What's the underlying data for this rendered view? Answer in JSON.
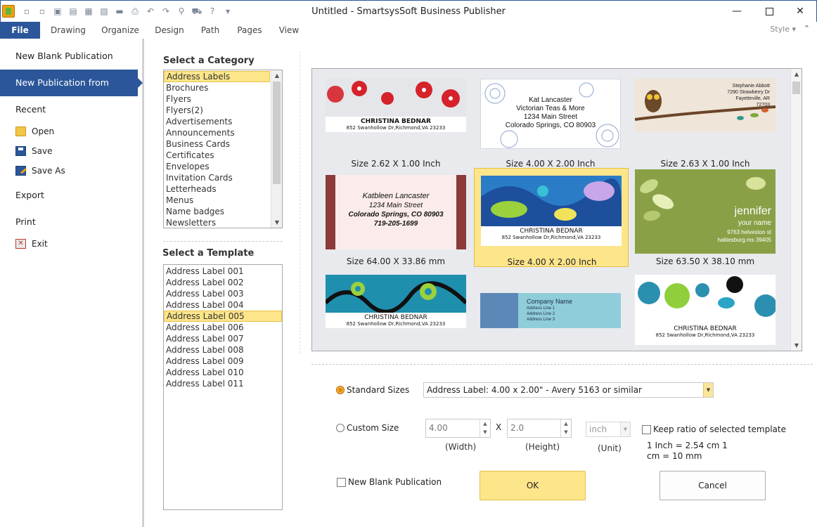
{
  "window": {
    "title": "Untitled - SmartsysSoft Business Publisher",
    "minimize": "—",
    "close": "✕"
  },
  "ribbon": {
    "tabs": [
      "File",
      "Drawing",
      "Organize",
      "Design",
      "Path",
      "Pages",
      "View"
    ],
    "style_label": "Style",
    "style_caret": "▾",
    "collapse_icon": "⌃"
  },
  "qat_icons": [
    "▫",
    "▫",
    "▣",
    "▤",
    "▦",
    "▧",
    "▬",
    "⎙",
    "↶",
    "↷",
    "⚲",
    "⛟",
    "?",
    "▾"
  ],
  "backstage": {
    "new_blank": "New Blank Publication",
    "new_from_template": "New Publication from Template",
    "recent": "Recent",
    "open": "Open",
    "save": "Save",
    "save_as": "Save As",
    "export": "Export",
    "print": "Print",
    "exit": "Exit",
    "exit_glyph": "✕"
  },
  "category": {
    "heading": "Select a Category",
    "items": [
      "Address Labels",
      "Brochures",
      "Flyers",
      "Flyers(2)",
      "Advertisements",
      "Announcements",
      "Business Cards",
      "Certificates",
      "Envelopes",
      "Invitation Cards",
      "Letterheads",
      "Menus",
      "Name badges",
      "Newsletters"
    ],
    "selected_index": 0
  },
  "template": {
    "heading": "Select a Template",
    "items": [
      "Address Label 001",
      "Address Label 002",
      "Address Label 003",
      "Address Label 004",
      "Address Label 005",
      "Address Label 006",
      "Address Label 007",
      "Address Label 008",
      "Address Label 009",
      "Address Label 010",
      "Address Label 011"
    ],
    "selected_index": 4
  },
  "gallery": {
    "cards": [
      {
        "size": "Size 2.62 X 1.00 Inch",
        "name": "CHRISTINA BEDNAR",
        "addr": "852 Swanhollow Dr,Richmond,VA 23233"
      },
      {
        "size": "Size 4.00 X 2.00 Inch",
        "l1": "Kat Lancaster",
        "l2": "Victorian Teas & More",
        "l3": "1234 Main Street",
        "l4": "Colorado Springs, CO 80903"
      },
      {
        "size": "Size 2.63 X 1.00 Inch",
        "l1": "Stephanie Abbott",
        "l2": "7290 Strawberry Dr",
        "l3": "Fayetteville, AR",
        "l4": "72703"
      },
      {
        "size": "Size 64.00 X 33.86 mm",
        "l1": "Katbleen Lancaster",
        "l2": "1234 Main Street",
        "l3": "Colorado Springs, CO 80903",
        "l4": "719-205-1699"
      },
      {
        "size": "Size 4.00 X 2.00 Inch",
        "name": "CHRISTINA BEDNAR",
        "addr": "852 Swanhollow Dr,Richmond,VA 23233"
      },
      {
        "size": "Size 63.50 X 38.10 mm",
        "l1": "jennifer",
        "l2": "your name",
        "l3": "9763 helveston st",
        "l4": "haltiesburg.ms 39405"
      },
      {
        "size": "",
        "name": "CHRISTINA BEDNAR",
        "addr": "852 Swanhollow Dr,Richmond,VA 23233"
      },
      {
        "size": "",
        "l1": "Company Name",
        "l2": "Address Line 1",
        "l3": "Address Line 2",
        "l4": "Address Line 3"
      },
      {
        "size": "",
        "name": "CHRISTINA BEDNAR",
        "addr": "852 Swanhollow Dr,Richmond,VA 23233"
      }
    ],
    "selected_index": 4
  },
  "form": {
    "standard_sizes_label": "Standard Sizes",
    "standard_sizes_value": "Address Label: 4.00 x 2.00\" - Avery 5163 or similar",
    "custom_size_label": "Custom Size",
    "width_value": "4.00",
    "x_label": "X",
    "height_value": "2.0",
    "unit_value": "inch",
    "width_caption": "(Width)",
    "height_caption": "(Height)",
    "unit_caption": "(Unit)",
    "keep_ratio_label": "Keep ratio of selected template",
    "conversion_1": "1 Inch = 2.54 cm  1",
    "conversion_2": "cm = 10 mm",
    "new_blank_label": "New Blank Publication",
    "ok": "OK",
    "cancel": "Cancel"
  }
}
